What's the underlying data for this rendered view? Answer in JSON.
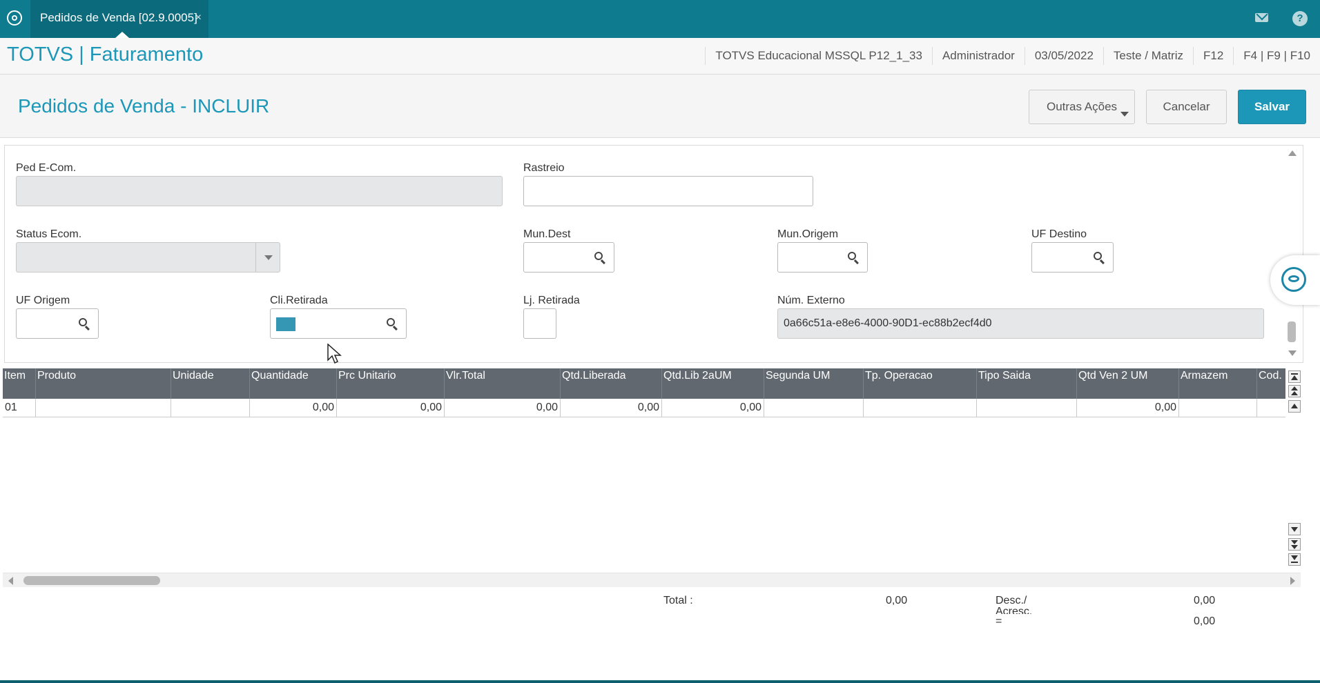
{
  "tab": {
    "title": "Pedidos de Venda [02.9.0005]",
    "close": "×"
  },
  "app": {
    "title": "TOTVS | Faturamento",
    "environment": "TOTVS Educacional MSSQL P12_1_33",
    "user": "Administrador",
    "date": "03/05/2022",
    "branch": "Teste / Matriz",
    "f12": "F12",
    "shortcuts": "F4 | F9 | F10"
  },
  "page": {
    "title": "Pedidos de Venda - INCLUIR",
    "outras_label": "Outras Ações",
    "cancelar_label": "Cancelar",
    "salvar_label": "Salvar"
  },
  "form": {
    "ped_ecom": {
      "label": "Ped E-Com.",
      "value": ""
    },
    "rastreio": {
      "label": "Rastreio",
      "value": ""
    },
    "status_ecom": {
      "label": "Status Ecom.",
      "value": ""
    },
    "mun_dest": {
      "label": "Mun.Dest",
      "value": ""
    },
    "mun_origem": {
      "label": "Mun.Origem",
      "value": ""
    },
    "uf_destino": {
      "label": "UF Destino",
      "value": ""
    },
    "uf_origem": {
      "label": "UF Origem",
      "value": ""
    },
    "cli_retirada": {
      "label": "Cli.Retirada",
      "value": ""
    },
    "lj_retirada": {
      "label": "Lj. Retirada",
      "value": ""
    },
    "num_externo": {
      "label": "Núm. Externo",
      "value": "0a66c51a-e8e6-4000-90D1-ec88b2ecf4d0"
    }
  },
  "grid": {
    "headers": {
      "item": "Item",
      "produto": "Produto",
      "unidade": "Unidade",
      "quantidade": "Quantidade",
      "prc_unitario": "Prc Unitario",
      "vlr_total": "Vlr.Total",
      "qtd_liberada": "Qtd.Liberada",
      "qtd_lib_2aum": "Qtd.Lib 2aUM",
      "segunda_um": "Segunda UM",
      "tp_operacao": "Tp. Operacao",
      "tipo_saida": "Tipo Saida",
      "qtd_ven_2um": "Qtd Ven 2 UM",
      "armazem": "Armazem",
      "cod": "Cod. I"
    },
    "row": {
      "item": "01",
      "produto": "",
      "unidade": "",
      "quantidade": "0,00",
      "prc_unitario": "0,00",
      "vlr_total": "0,00",
      "qtd_liberada": "0,00",
      "qtd_lib_2aum": "0,00",
      "segunda_um": "",
      "tp_operacao": "",
      "tipo_saida": "",
      "qtd_ven_2um": "0,00",
      "armazem": "",
      "cod": ""
    }
  },
  "totals": {
    "total_label": "Total :",
    "total_value": "0,00",
    "desc_label": "Desc./",
    "desc_label2": "Acresc.",
    "desc_value": "0,00",
    "eq_label": "=",
    "eq_value": "0,00"
  },
  "icons": {
    "logo": "totvs-logo-icon",
    "mail": "mail-icon",
    "help": "help-icon",
    "search": "search-icon",
    "chat": "chat-assistant-icon"
  },
  "colors": {
    "brand": "#0e7b8f",
    "accent": "#1c97b8",
    "grid_header": "#616870"
  }
}
